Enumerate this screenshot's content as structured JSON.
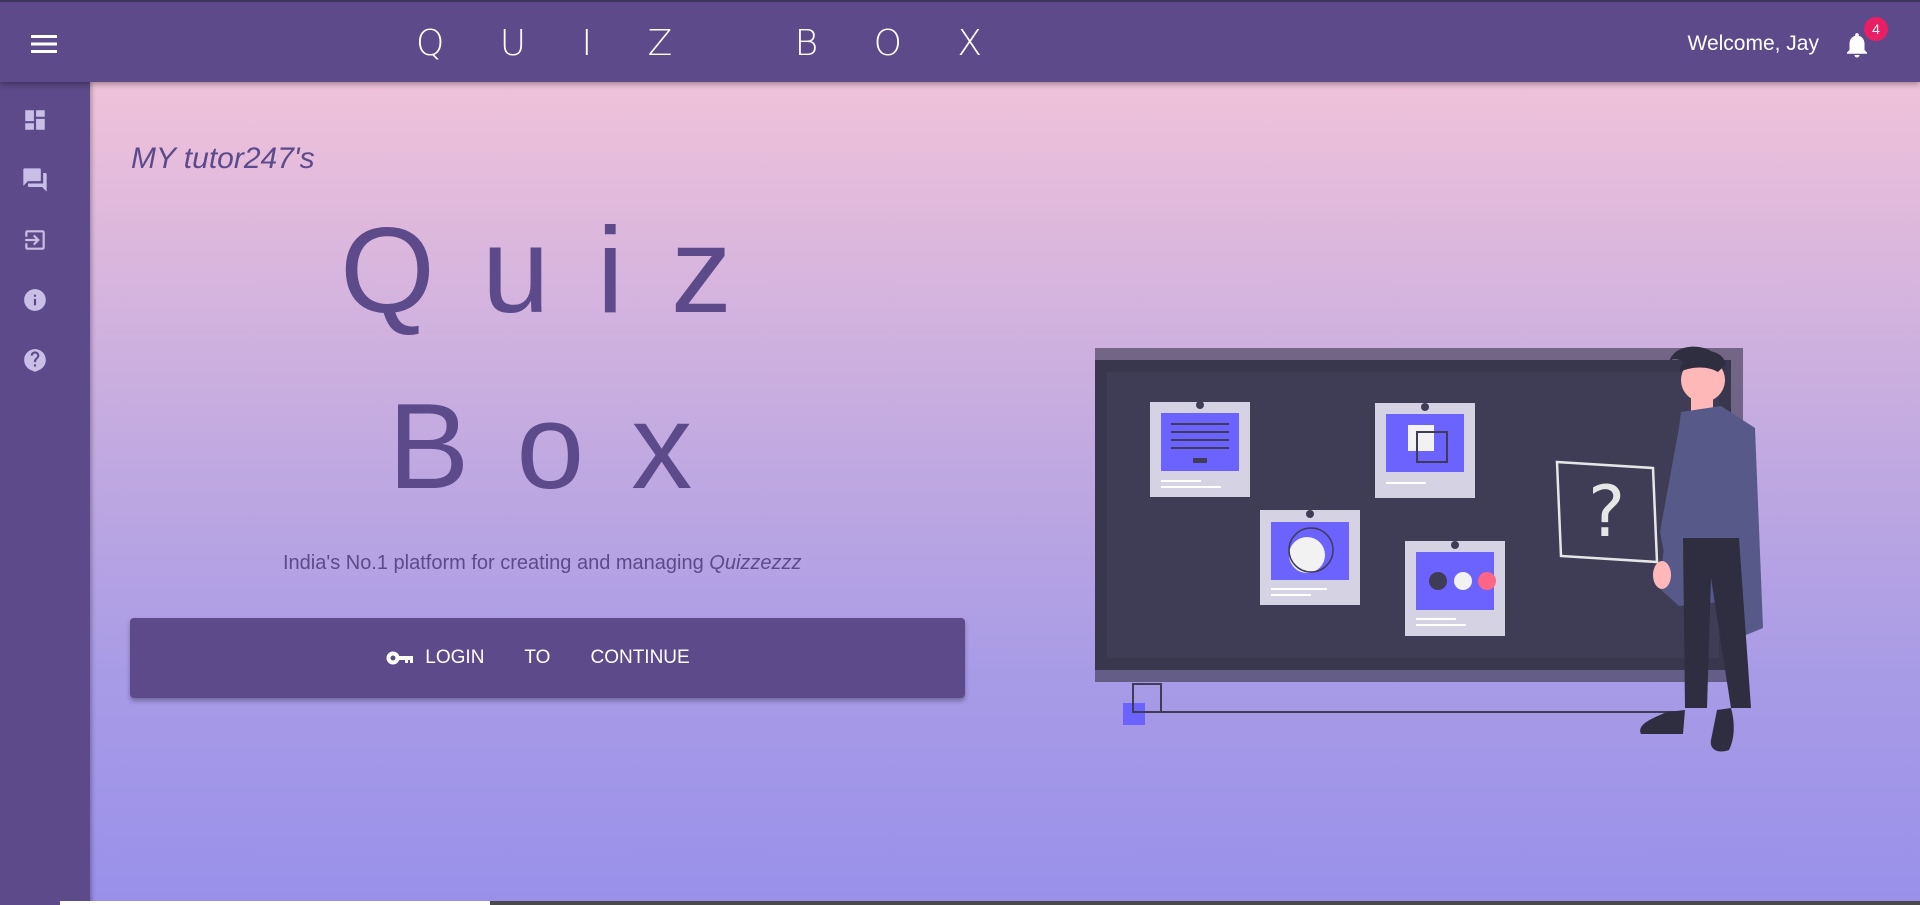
{
  "header": {
    "brand": "Q U I Z   B O X",
    "welcome": "Welcome, Jay",
    "notification_count": "4"
  },
  "sidebar": {
    "items": [
      {
        "icon": "dashboard-icon"
      },
      {
        "icon": "forum-icon"
      },
      {
        "icon": "login-icon"
      },
      {
        "icon": "info-icon"
      },
      {
        "icon": "help-icon"
      }
    ]
  },
  "main": {
    "tagline": "MY tutor247's",
    "hero_line1": "Quiz",
    "hero_line2": "Box",
    "subtitle_prefix": "India's No.1 platform for creating and managing",
    "subtitle_em": "Quizzezzz",
    "login_button": {
      "word1": "LOGIN",
      "word2": "TO",
      "word3": "CONTINUE"
    }
  },
  "colors": {
    "primary": "#5c4a8a",
    "badge": "#e91e63",
    "accent": "#6c63ff",
    "board": "#3f3d56"
  }
}
